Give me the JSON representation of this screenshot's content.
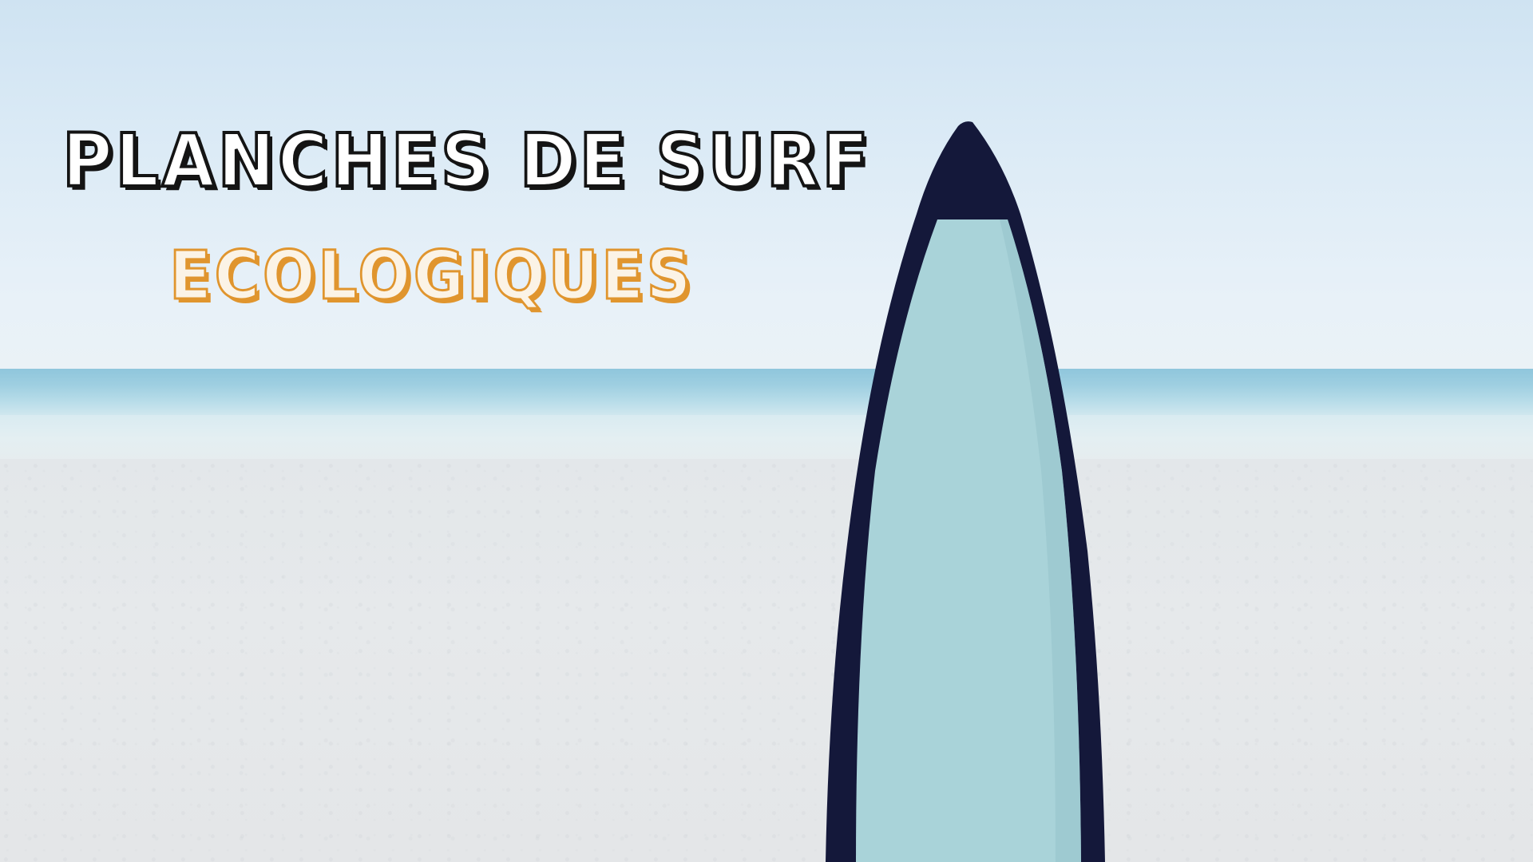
{
  "headline": {
    "line1": "PLANCHES DE SURF",
    "line2": "ECOLOGIQUES"
  },
  "colors": {
    "line1_outline": "#141414",
    "line2_outline": "#e0952e",
    "board_rail": "#14183a",
    "board_deck": "#a9d3d9",
    "sea": "#9fcfe1",
    "sand": "#e4e7ea",
    "sky": "#dcebf6"
  },
  "scene_elements": [
    "sky",
    "sea",
    "beach-sand",
    "surfboard"
  ]
}
